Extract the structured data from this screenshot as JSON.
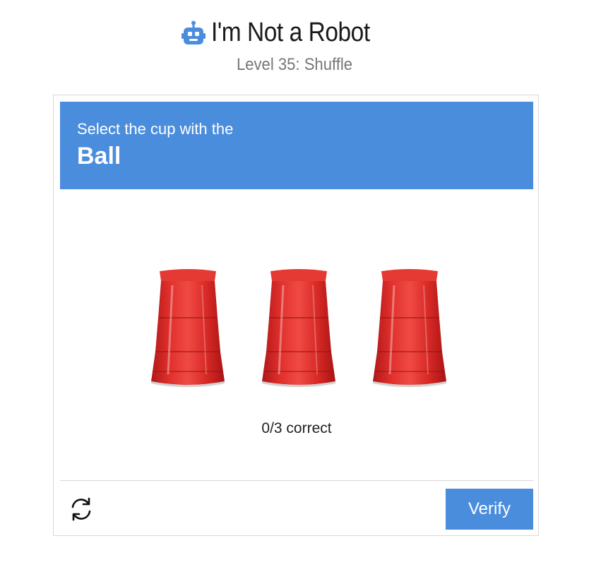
{
  "app": {
    "title": "I'm Not a Robot",
    "subtitle": "Level 35: Shuffle",
    "title_icon": "robot-icon"
  },
  "challenge": {
    "instruction": "Select the cup with the",
    "target": "Ball",
    "banner_color": "#4a8ddd"
  },
  "cups": {
    "count": 3,
    "color": "#d92b2b",
    "icon": "red-cup"
  },
  "status": {
    "progress_text": "0/3 correct"
  },
  "footer": {
    "refresh_icon": "refresh-icon",
    "verify_label": "Verify",
    "verify_color": "#4a8ddd"
  }
}
